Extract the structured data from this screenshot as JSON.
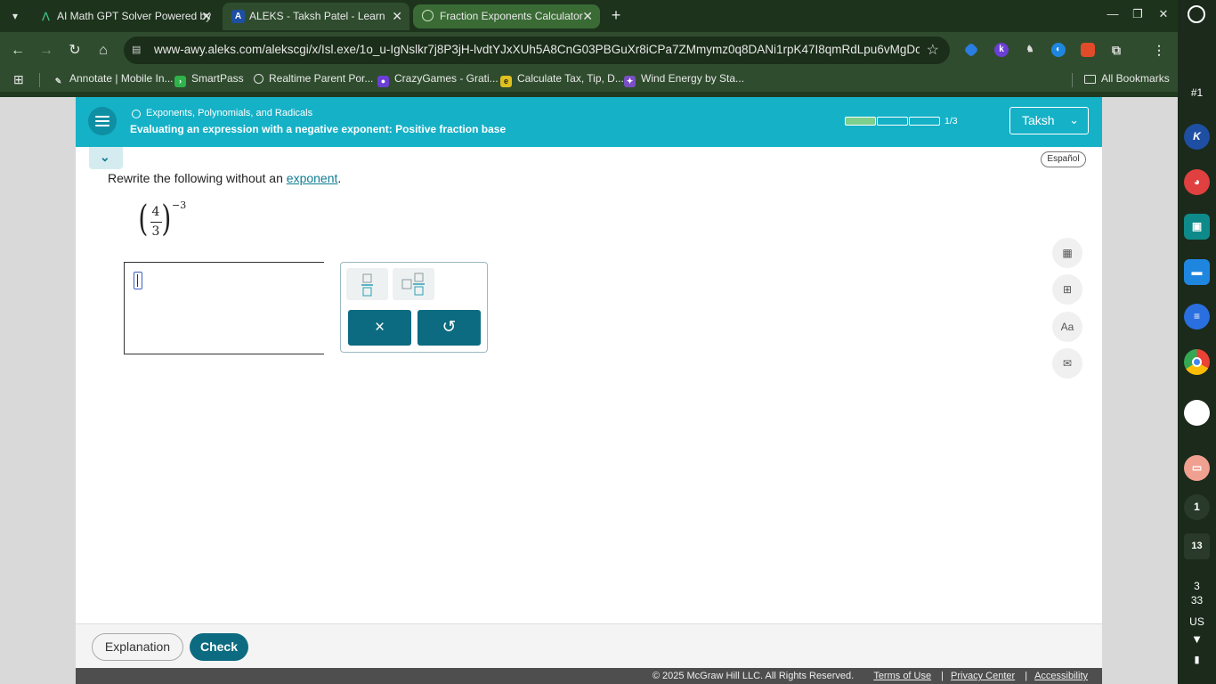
{
  "browser": {
    "tabs": [
      {
        "title": "AI Math GPT Solver Powered by",
        "active": false
      },
      {
        "title": "ALEKS - Taksh Patel - Learn",
        "active": true
      },
      {
        "title": "Fraction Exponents Calculator",
        "active": false
      }
    ],
    "url": "www-awy.aleks.com/alekscgi/x/Isl.exe/1o_u-IgNslkr7j8P3jH-lvdtYJxXUh5A8CnG03PBGuXr8iCPa7ZMmymz0q8DANi1rpK47I8qmRdLpu6vMgDclv2gm...",
    "bookmarks": [
      {
        "label": "Annotate | Mobile In...",
        "color": "#1b1b1b"
      },
      {
        "label": "SmartPass",
        "color": "#2fb34a"
      },
      {
        "label": "Realtime Parent Por...",
        "color": "#888888"
      },
      {
        "label": "CrazyGames - Grati...",
        "color": "#6b3fd6"
      },
      {
        "label": "Calculate Tax, Tip, D...",
        "color": "#e0c020"
      },
      {
        "label": "Wind Energy by Sta...",
        "color": "#7a4fc4"
      }
    ],
    "all_bookmarks": "All Bookmarks"
  },
  "aleks": {
    "topic": "Exponents, Polynomials, and Radicals",
    "title": "Evaluating an expression with a negative exponent: Positive fraction base",
    "progress": {
      "label": "1/3",
      "completed": 1,
      "total": 3
    },
    "user": "Taksh",
    "espanol": "Español",
    "prompt_before": "Rewrite the following without an",
    "prompt_link": "exponent",
    "prompt_after": ".",
    "expression": {
      "numerator": "4",
      "denominator": "3",
      "exponent": "−3"
    },
    "buttons": {
      "explanation": "Explanation",
      "check": "Check",
      "clear": "×",
      "undo": "↺"
    }
  },
  "footer": {
    "copyright": "© 2025 McGraw Hill LLC. All Rights Reserved.",
    "terms": "Terms of Use",
    "privacy": "Privacy Center",
    "accessibility": "Accessibility"
  },
  "shelf": {
    "desk": "#1",
    "date": "13",
    "time_h": "3",
    "time_m": "33",
    "locale": "US",
    "notif": "1"
  }
}
